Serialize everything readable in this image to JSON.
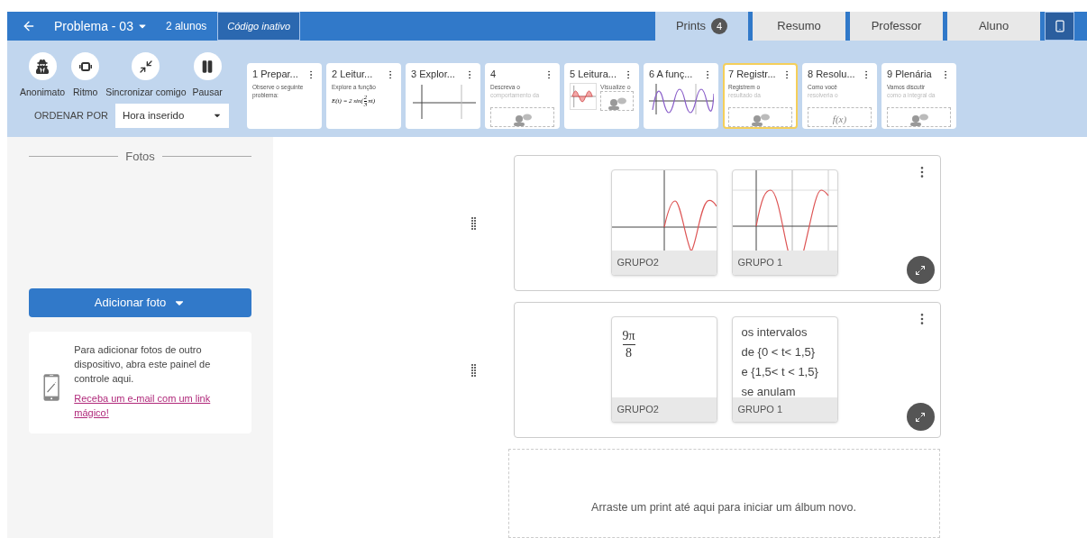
{
  "header": {
    "title": "Problema - 03",
    "students": "2 alunos",
    "code_button": "Código inativo"
  },
  "tabs": [
    {
      "label": "Prints",
      "badge": "4",
      "selected": true
    },
    {
      "label": "Resumo",
      "selected": false
    },
    {
      "label": "Professor",
      "selected": false
    },
    {
      "label": "Aluno",
      "selected": false
    }
  ],
  "actions": [
    {
      "label": "Anonimato",
      "kind": "incognito"
    },
    {
      "label": "Ritmo",
      "kind": "pace"
    },
    {
      "label": "Sincronizar comigo",
      "kind": "sync"
    },
    {
      "label": "Pausar",
      "kind": "pause"
    }
  ],
  "sort": {
    "label": "ORDENAR POR",
    "value": "Hora inserido"
  },
  "slides": [
    {
      "title": "1 Prepar...",
      "selected": false,
      "text": "Observe o seguinte problema:"
    },
    {
      "title": "2 Leitur...",
      "selected": false,
      "text": "Explore a função",
      "figure": {
        "kind": "formula",
        "prefix": "E(t) = 2 sin(",
        "numerator": "2",
        "denominator": "3",
        "suffix": "πt)"
      }
    },
    {
      "title": "3 Explor...",
      "selected": false,
      "figure": {
        "kind": "axes"
      }
    },
    {
      "title": "4",
      "selected": false,
      "text": "Descreva o",
      "faded_text": "comportamento da",
      "response": {
        "kind": "people"
      }
    },
    {
      "title": "5 Leitura...",
      "selected": false,
      "text": "Visualize o",
      "figure": {
        "kind": "redwave"
      },
      "response": {
        "kind": "people"
      }
    },
    {
      "title": "6 A funç...",
      "selected": false,
      "figure": {
        "kind": "wave"
      }
    },
    {
      "title": "7 Registr...",
      "selected": true,
      "text": "Registrem o",
      "faded_text": "resultado da",
      "response": {
        "kind": "people"
      }
    },
    {
      "title": "8 Resolu...",
      "selected": false,
      "text": "Como você",
      "faded_text": "resolveria o",
      "response": {
        "kind": "formula",
        "text": "f(x)"
      }
    },
    {
      "title": "9 Plenária",
      "selected": false,
      "text": "Vamos discutir",
      "faded_text": "como a integral da",
      "response": {
        "kind": "people"
      }
    }
  ],
  "photos": {
    "title": "Fotos",
    "add_button": "Adicionar foto",
    "info": "Para adicionar fotos de outro dispositivo, abra este painel de controle aqui.",
    "link": "Receba um e-mail com um link mágico!"
  },
  "albums": [
    {
      "prints": [
        {
          "group": "GRUPO2",
          "kind": "graph"
        },
        {
          "group": "GRUPO 1",
          "kind": "grid_graph"
        }
      ]
    },
    {
      "prints": [
        {
          "group": "GRUPO2",
          "kind": "fraction",
          "numerator": "9π",
          "denominator": "8"
        },
        {
          "group": "GRUPO 1",
          "kind": "text",
          "lines": [
            "os intervalos",
            "de {0 < t< 1,5}",
            "e {1,5< t < 1,5}",
            "se anulam"
          ]
        }
      ]
    }
  ],
  "dropzone": "Arraste um print até aqui para iniciar um álbum novo."
}
